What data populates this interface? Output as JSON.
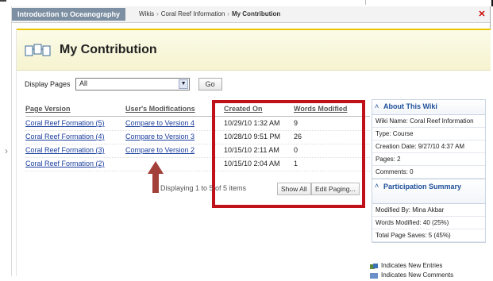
{
  "breadcrumb": {
    "course": "Introduction to Oceanography",
    "items": [
      "Wikis",
      "Coral Reef Information",
      "My Contribution"
    ]
  },
  "page": {
    "title": "My Contribution"
  },
  "controls": {
    "display_label": "Display Pages",
    "selected": "All",
    "go_label": "Go"
  },
  "table": {
    "headers": [
      "Page Version",
      "User's Modifications",
      "Created On",
      "Words Modified"
    ],
    "rows": [
      {
        "page_version": "Coral Reef Formation (5)",
        "modification": "Compare to Version 4",
        "created_on": "10/29/10 1:32 AM",
        "words": "9"
      },
      {
        "page_version": "Coral Reef Formation (4)",
        "modification": "Compare to Version 3",
        "created_on": "10/28/10 9:51 PM",
        "words": "26"
      },
      {
        "page_version": "Coral Reef Formation (3)",
        "modification": "Compare to Version 2",
        "created_on": "10/15/10 2:11 AM",
        "words": "0"
      },
      {
        "page_version": "Coral Reef Formation (2)",
        "modification": "",
        "created_on": "10/15/10 2:04 AM",
        "words": "1"
      }
    ]
  },
  "pager": {
    "text": "Displaying 1 to 5 of 5 items",
    "show_all": "Show All",
    "edit_paging": "Edit Paging..."
  },
  "about": {
    "title": "About This Wiki",
    "lines": [
      "Wiki Name: Coral Reef Information",
      "Type: Course",
      "Creation Date: 9/27/10 4:37 AM",
      "Pages: 2",
      "Comments: 0"
    ]
  },
  "participation": {
    "title": "Participation Summary",
    "lines": [
      "Modified By: Mina Akbar",
      "Words Modified: 40 (25%)",
      "Total Page Saves: 5 (45%)"
    ]
  },
  "legend": [
    "Indicates New Entries",
    "Indicates New Comments"
  ],
  "colors": {
    "accent_bar": "#7d8fa2",
    "highlight_box": "#c0101a",
    "arrow": "#a3403a",
    "title_bg": "#f5f3cf",
    "link": "#1a3e9c"
  }
}
